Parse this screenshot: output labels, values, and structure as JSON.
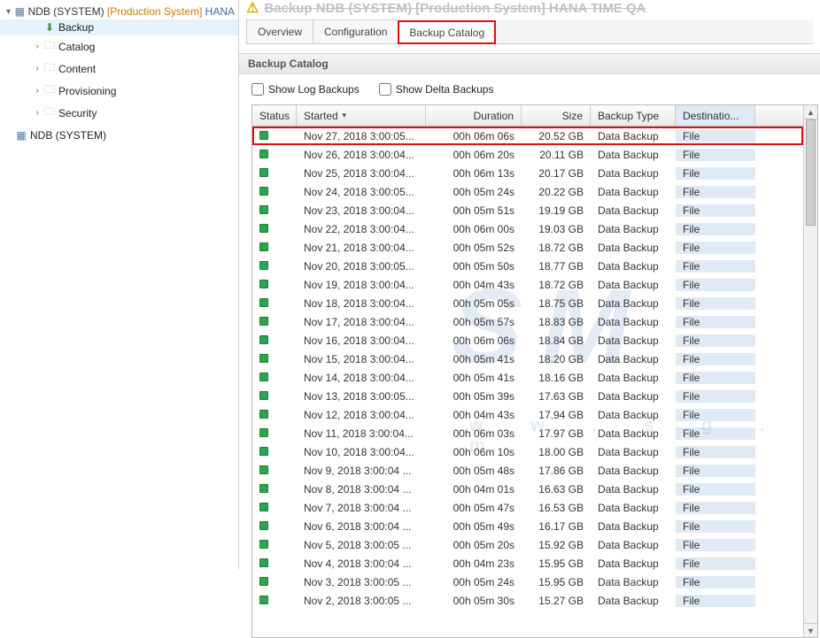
{
  "sidebar": {
    "root": {
      "label_sys": "NDB (SYSTEM)",
      "label_prod": "[Production System]",
      "label_hana": "HANA"
    },
    "items": [
      {
        "label": "Backup",
        "selected": true,
        "icon": "download"
      },
      {
        "label": "Catalog",
        "selected": false,
        "icon": "folder"
      },
      {
        "label": "Content",
        "selected": false,
        "icon": "folder"
      },
      {
        "label": "Provisioning",
        "selected": false,
        "icon": "folder"
      },
      {
        "label": "Security",
        "selected": false,
        "icon": "folder"
      }
    ],
    "second_root": "NDB (SYSTEM)"
  },
  "header": {
    "title_fragment": "Backup NDB (SYSTEM) [Production System] HANA TIME QA"
  },
  "tabs": [
    {
      "label": "Overview",
      "active": false
    },
    {
      "label": "Configuration",
      "active": false
    },
    {
      "label": "Backup Catalog",
      "active": true
    }
  ],
  "section_title": "Backup Catalog",
  "toolbar": {
    "log_label": "Show Log Backups",
    "delta_label": "Show Delta Backups",
    "log_checked": false,
    "delta_checked": false
  },
  "columns": {
    "status": "Status",
    "started": "Started",
    "duration": "Duration",
    "size": "Size",
    "type": "Backup Type",
    "dest": "Destinatio..."
  },
  "rows": [
    {
      "started": "Nov 27, 2018 3:00:05...",
      "duration": "00h 06m 06s",
      "size": "20.52 GB",
      "type": "Data Backup",
      "dest": "File"
    },
    {
      "started": "Nov 26, 2018 3:00:04...",
      "duration": "00h 06m 20s",
      "size": "20.11 GB",
      "type": "Data Backup",
      "dest": "File"
    },
    {
      "started": "Nov 25, 2018 3:00:04...",
      "duration": "00h 06m 13s",
      "size": "20.17 GB",
      "type": "Data Backup",
      "dest": "File"
    },
    {
      "started": "Nov 24, 2018 3:00:05...",
      "duration": "00h 05m 24s",
      "size": "20.22 GB",
      "type": "Data Backup",
      "dest": "File"
    },
    {
      "started": "Nov 23, 2018 3:00:04...",
      "duration": "00h 05m 51s",
      "size": "19.19 GB",
      "type": "Data Backup",
      "dest": "File"
    },
    {
      "started": "Nov 22, 2018 3:00:04...",
      "duration": "00h 06m 00s",
      "size": "19.03 GB",
      "type": "Data Backup",
      "dest": "File"
    },
    {
      "started": "Nov 21, 2018 3:00:04...",
      "duration": "00h 05m 52s",
      "size": "18.72 GB",
      "type": "Data Backup",
      "dest": "File"
    },
    {
      "started": "Nov 20, 2018 3:00:05...",
      "duration": "00h 05m 50s",
      "size": "18.77 GB",
      "type": "Data Backup",
      "dest": "File"
    },
    {
      "started": "Nov 19, 2018 3:00:04...",
      "duration": "00h 04m 43s",
      "size": "18.72 GB",
      "type": "Data Backup",
      "dest": "File"
    },
    {
      "started": "Nov 18, 2018 3:00:04...",
      "duration": "00h 05m 05s",
      "size": "18.75 GB",
      "type": "Data Backup",
      "dest": "File"
    },
    {
      "started": "Nov 17, 2018 3:00:04...",
      "duration": "00h 05m 57s",
      "size": "18.83 GB",
      "type": "Data Backup",
      "dest": "File"
    },
    {
      "started": "Nov 16, 2018 3:00:04...",
      "duration": "00h 06m 06s",
      "size": "18.84 GB",
      "type": "Data Backup",
      "dest": "File"
    },
    {
      "started": "Nov 15, 2018 3:00:04...",
      "duration": "00h 05m 41s",
      "size": "18.20 GB",
      "type": "Data Backup",
      "dest": "File"
    },
    {
      "started": "Nov 14, 2018 3:00:04...",
      "duration": "00h 05m 41s",
      "size": "18.16 GB",
      "type": "Data Backup",
      "dest": "File"
    },
    {
      "started": "Nov 13, 2018 3:00:05...",
      "duration": "00h 05m 39s",
      "size": "17.63 GB",
      "type": "Data Backup",
      "dest": "File"
    },
    {
      "started": "Nov 12, 2018 3:00:04...",
      "duration": "00h 04m 43s",
      "size": "17.94 GB",
      "type": "Data Backup",
      "dest": "File"
    },
    {
      "started": "Nov 11, 2018 3:00:04...",
      "duration": "00h 06m 03s",
      "size": "17.97 GB",
      "type": "Data Backup",
      "dest": "File"
    },
    {
      "started": "Nov 10, 2018 3:00:04...",
      "duration": "00h 06m 10s",
      "size": "18.00 GB",
      "type": "Data Backup",
      "dest": "File"
    },
    {
      "started": "Nov 9, 2018 3:00:04 ...",
      "duration": "00h 05m 48s",
      "size": "17.86 GB",
      "type": "Data Backup",
      "dest": "File"
    },
    {
      "started": "Nov 8, 2018 3:00:04 ...",
      "duration": "00h 04m 01s",
      "size": "16.63 GB",
      "type": "Data Backup",
      "dest": "File"
    },
    {
      "started": "Nov 7, 2018 3:00:04 ...",
      "duration": "00h 05m 47s",
      "size": "16.53 GB",
      "type": "Data Backup",
      "dest": "File"
    },
    {
      "started": "Nov 6, 2018 3:00:04 ...",
      "duration": "00h 05m 49s",
      "size": "16.17 GB",
      "type": "Data Backup",
      "dest": "File"
    },
    {
      "started": "Nov 5, 2018 3:00:05 ...",
      "duration": "00h 05m 20s",
      "size": "15.92 GB",
      "type": "Data Backup",
      "dest": "File"
    },
    {
      "started": "Nov 4, 2018 3:00:04 ...",
      "duration": "00h 04m 23s",
      "size": "15.95 GB",
      "type": "Data Backup",
      "dest": "File"
    },
    {
      "started": "Nov 3, 2018 3:00:05 ...",
      "duration": "00h 05m 24s",
      "size": "15.95 GB",
      "type": "Data Backup",
      "dest": "File"
    },
    {
      "started": "Nov 2, 2018 3:00:05 ...",
      "duration": "00h 05m 30s",
      "size": "15.27 GB",
      "type": "Data Backup",
      "dest": "File"
    }
  ]
}
